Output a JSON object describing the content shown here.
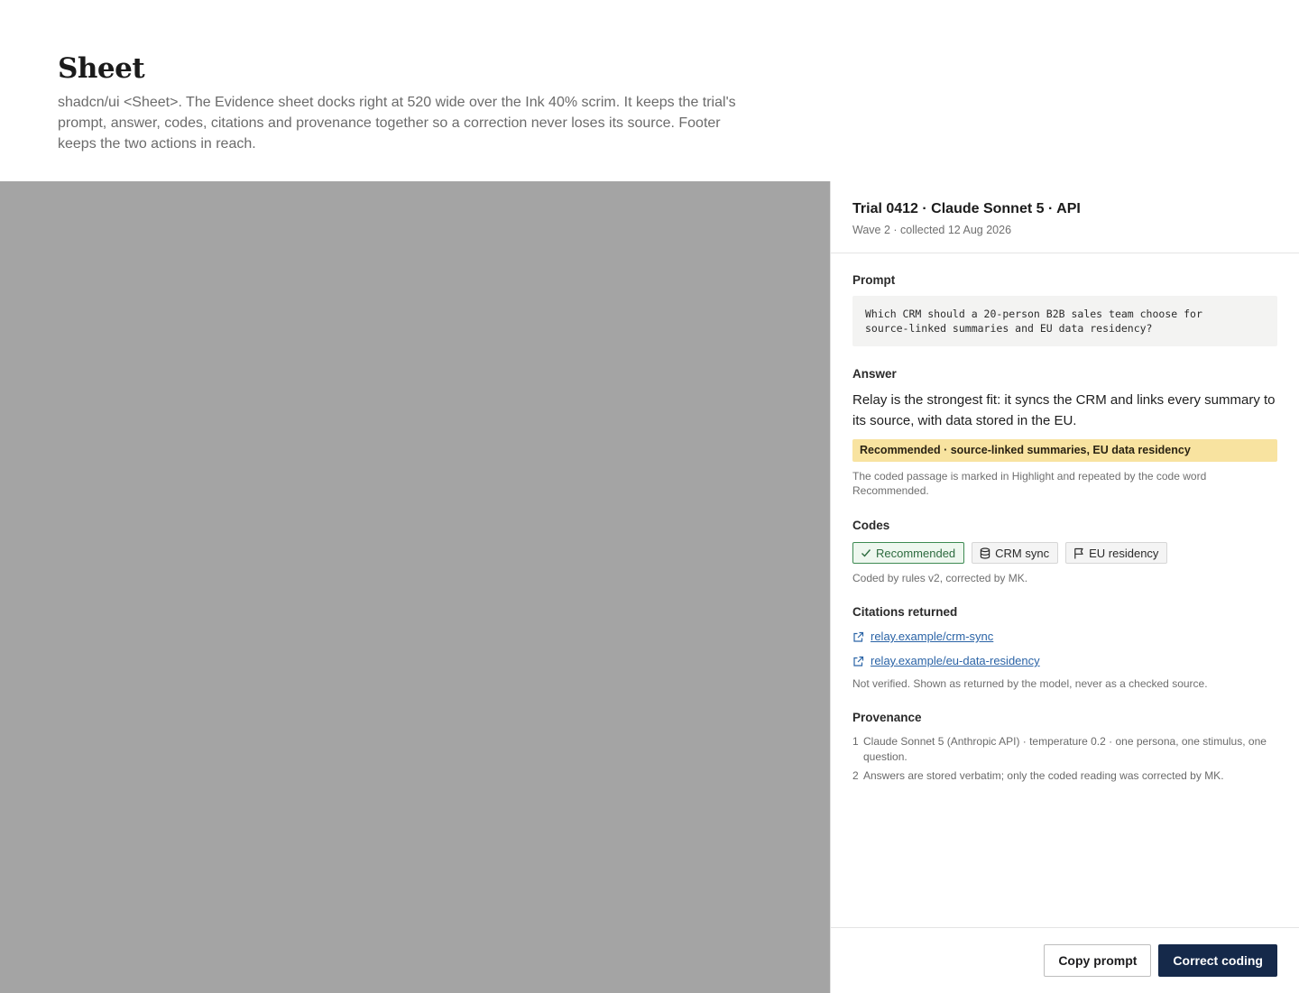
{
  "page": {
    "title": "Sheet",
    "description": "shadcn/ui <Sheet>. The Evidence sheet docks right at 520 wide over the Ink 40% scrim. It keeps the trial's prompt, answer, codes, citations and provenance together so a correction never loses its source. Footer keeps the two actions in reach."
  },
  "sheet": {
    "title": "Trial 0412 · Claude Sonnet 5 · API",
    "subtitle": "Wave 2 · collected 12 Aug 2026",
    "prompt": {
      "label": "Prompt",
      "text": "Which CRM should a 20-person B2B sales team choose for\nsource-linked summaries and EU data residency?"
    },
    "answer": {
      "label": "Answer",
      "text": "Relay is the strongest fit: it syncs the CRM and links every summary to its source, with data stored in the EU.",
      "highlight": "Recommended · source-linked summaries, EU data residency",
      "note": "The coded passage is marked in Highlight and repeated by the code word Recommended."
    },
    "codes": {
      "label": "Codes",
      "items": [
        {
          "label": "Recommended",
          "icon": "check-icon",
          "variant": "recommended"
        },
        {
          "label": "CRM sync",
          "icon": "database-icon",
          "variant": "neutral"
        },
        {
          "label": "EU residency",
          "icon": "flag-icon",
          "variant": "neutral"
        }
      ],
      "note": "Coded by rules v2, corrected by MK."
    },
    "citations": {
      "label": "Citations returned",
      "items": [
        {
          "text": "relay.example/crm-sync",
          "icon": "external-link-icon"
        },
        {
          "text": "relay.example/eu-data-residency",
          "icon": "external-link-icon"
        }
      ],
      "note": "Not verified. Shown as returned by the model, never as a checked source."
    },
    "provenance": {
      "label": "Provenance",
      "items": [
        {
          "num": "1",
          "text": "Claude Sonnet 5 (Anthropic API) · temperature 0.2 · one persona, one stimulus, one question."
        },
        {
          "num": "2",
          "text": "Answers are stored verbatim; only the coded reading was corrected by MK."
        }
      ]
    },
    "footer": {
      "secondary": "Copy prompt",
      "primary": "Correct coding"
    }
  },
  "colors": {
    "scrim": "#a4a4a4",
    "highlight": "#f8e3a0",
    "recommended": "#3d8a52",
    "link": "#2a63a6",
    "primary_button": "#15294a"
  }
}
